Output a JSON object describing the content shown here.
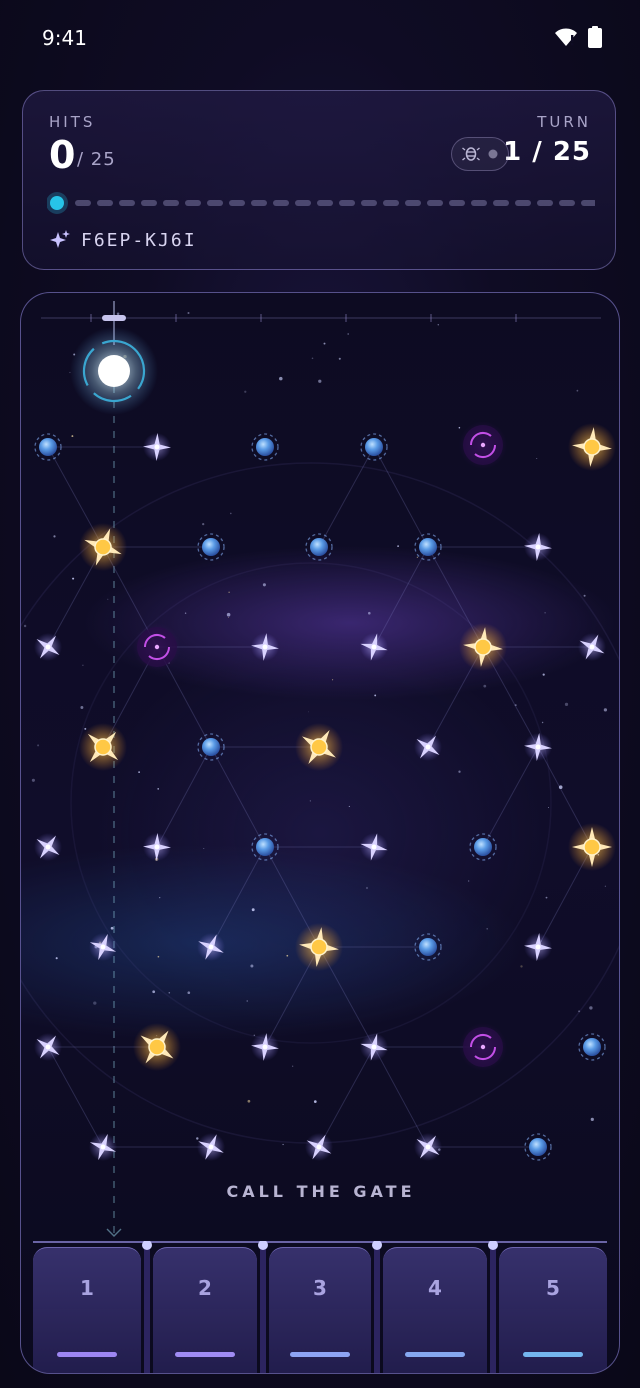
{
  "status_bar": {
    "time": "9:41"
  },
  "hud": {
    "hits_label": "HITS",
    "hits_value": "0",
    "hits_total": "/ 25",
    "turn_label": "TURN",
    "turn_value": "1 / 25",
    "progress": {
      "current": 1,
      "total": 25
    },
    "seed_code": "F6EP-KJ6I"
  },
  "board": {
    "cta_label": "CALL THE GATE"
  },
  "columns": [
    {
      "label": "1",
      "color": "#9d86f2"
    },
    {
      "label": "2",
      "color": "#a08cf4"
    },
    {
      "label": "3",
      "color": "#8ea4f4"
    },
    {
      "label": "4",
      "color": "#86a8f0"
    },
    {
      "label": "5",
      "color": "#74b6ee"
    }
  ],
  "colors": {
    "accent": "#27c4e8",
    "gold_star": "#ffc845",
    "blue_orb": "#4f8ed8",
    "vortex": "#b64ce0"
  }
}
